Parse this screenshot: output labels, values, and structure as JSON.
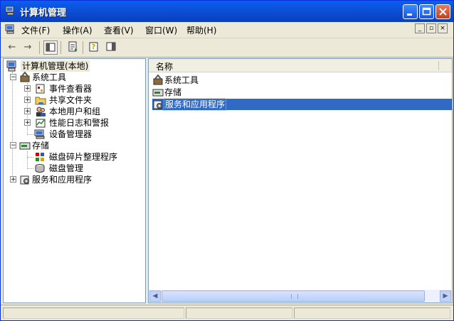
{
  "window": {
    "title": "计算机管理"
  },
  "menu": [
    "文件(F)",
    "操作(A)",
    "查看(V)",
    "窗口(W)",
    "帮助(H)"
  ],
  "tree": {
    "root": "计算机管理(本地)",
    "system_tools": "系统工具",
    "event_viewer": "事件查看器",
    "shared_folders": "共享文件夹",
    "local_users": "本地用户和组",
    "perf_logs": "性能日志和警报",
    "device_manager": "设备管理器",
    "storage": "存储",
    "defrag": "磁盘碎片整理程序",
    "disk_mgmt": "磁盘管理",
    "services_apps": "服务和应用程序"
  },
  "list": {
    "column_name": "名称",
    "items": [
      "系统工具",
      "存储",
      "服务和应用程序"
    ],
    "selected_index": 2
  },
  "colors": {
    "title_blue": "#0c4fd6",
    "selection": "#316ac5",
    "chrome": "#ece9d8"
  }
}
